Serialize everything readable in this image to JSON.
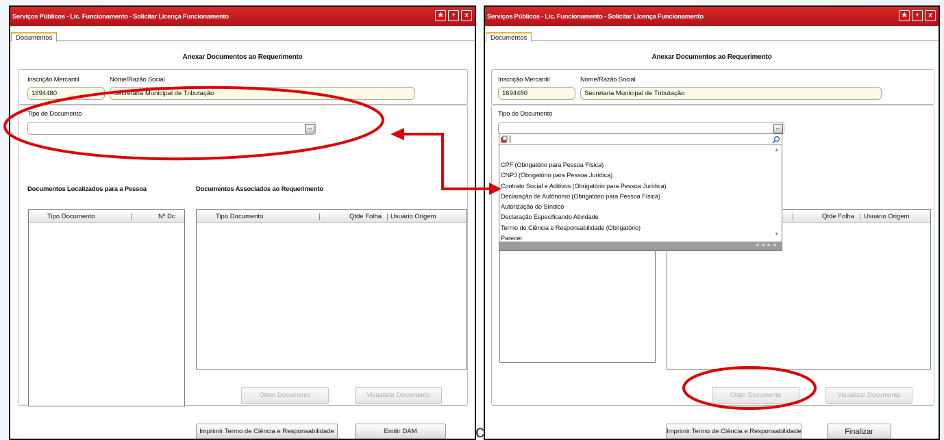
{
  "left_window": {
    "title": "Serviços Públicos - Lic. Funcionamento - Solicitar Licença Funcionamento",
    "tab": "Documentos",
    "section_title": "Anexar Documentos ao Requerimento",
    "inscricao_label": "Inscrição Mercantil",
    "inscricao_value": "1694480",
    "nome_label": "Nome/Razão Social",
    "nome_value": "Secretaria Municipal de Tributação",
    "tipo_doc_label": "Tipo de Documento",
    "tipo_doc_value": "",
    "dots": "...",
    "localizados_title": "Documentos  Localizados para a Pessoa",
    "associados_title": "Documentos Associados ao Requerimento",
    "loc_col_tipo": "Tipo Documento",
    "loc_col_num": "Nº Dc",
    "assoc_col_tipo": "Tipo Documento",
    "assoc_col_qtde": "Qtde Folha",
    "assoc_col_usuario": "Usuário Origem",
    "btn_obter": "Obter Documento",
    "btn_visualizar": "Visualizar Documento",
    "btn_imprimir": "Imprimir Termo de Ciência e Responsabilidade",
    "btn_emitir": "Emitir DAM"
  },
  "right_window": {
    "title": "Serviços Públicos - Lic. Funcionamento - Solicitar Licença Funcionamento",
    "tab": "Documentos",
    "section_title": "Anexar Documentos ao Requerimento",
    "inscricao_label": "Inscrição Mercantil",
    "inscricao_value": "1694480",
    "nome_label": "Nome/Razão Social",
    "nome_value": "Secretaria Municipal de Tributação",
    "tipo_doc_label": "Tipo de Documento",
    "dots": "...",
    "dropdown_items": [
      "CPF (Obrigatório para Pessoa Física)",
      "CNPJ (Obrigatório para Pessoa Jurídica)",
      "Contrato Social e Aditivos (Obrigatório para Pessoa Jurídica)",
      "Declaração de Autônomo (Obrigatório para Pessoa Física)",
      "Autorização do Síndico",
      "Declaração Especificando Atividade",
      "Termo de Ciência e Responsabilidade (Obrigatório)",
      "Parecer"
    ],
    "dropdown_nav": "◄ ◄ ► ►",
    "assoc_col_qtde": "Qtde Folha",
    "assoc_col_usuario": "Usuário Origem",
    "btn_obter": "Obter Documento",
    "btn_visualizar": "Visualizar Documento",
    "btn_imprimir": "Imprimir Termo de Ciência e Responsabilidade",
    "btn_finalizar": "Finalizar"
  },
  "title_buttons": {
    "star": "★",
    "menu": "▼",
    "close": "x"
  },
  "stray_char": "c",
  "colors": {
    "titlebar": "#c41a1f",
    "annotation": "#e00000",
    "field_bg": "#fdfbe6"
  }
}
